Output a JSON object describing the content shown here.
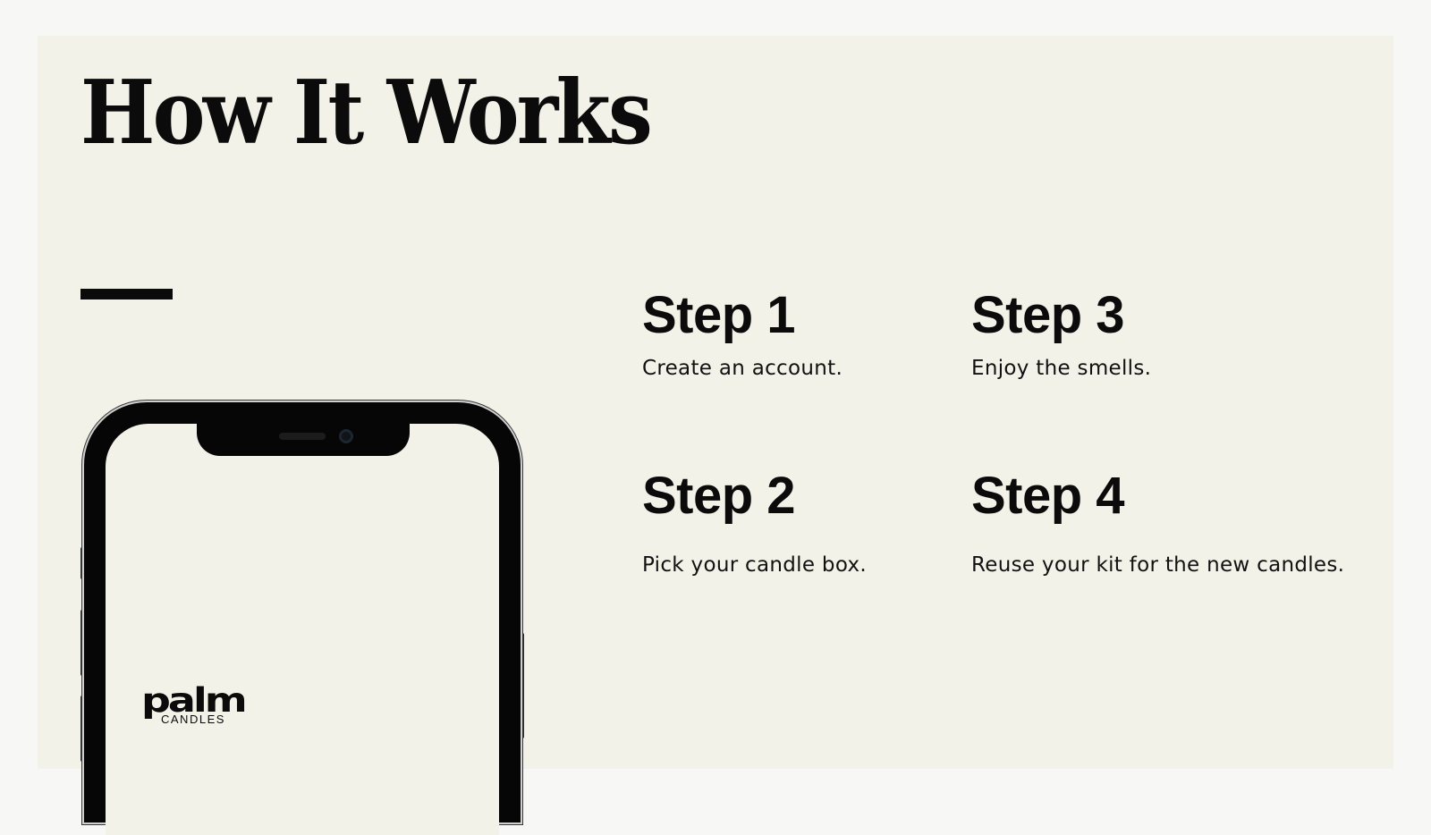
{
  "title": "How It Works",
  "steps": [
    {
      "heading": "Step 1",
      "text": "Create an account."
    },
    {
      "heading": "Step 2",
      "text": "Pick your candle box."
    },
    {
      "heading": "Step 3",
      "text": "Enjoy the smells."
    },
    {
      "heading": "Step 4",
      "text": "Reuse your kit for the new candles."
    }
  ],
  "phone": {
    "brand": "palm",
    "brand_sub": "CANDLES"
  },
  "colors": {
    "slide_background": "#f3f2e8",
    "page_background": "#f7f7f6",
    "text": "#0b0b0b"
  }
}
